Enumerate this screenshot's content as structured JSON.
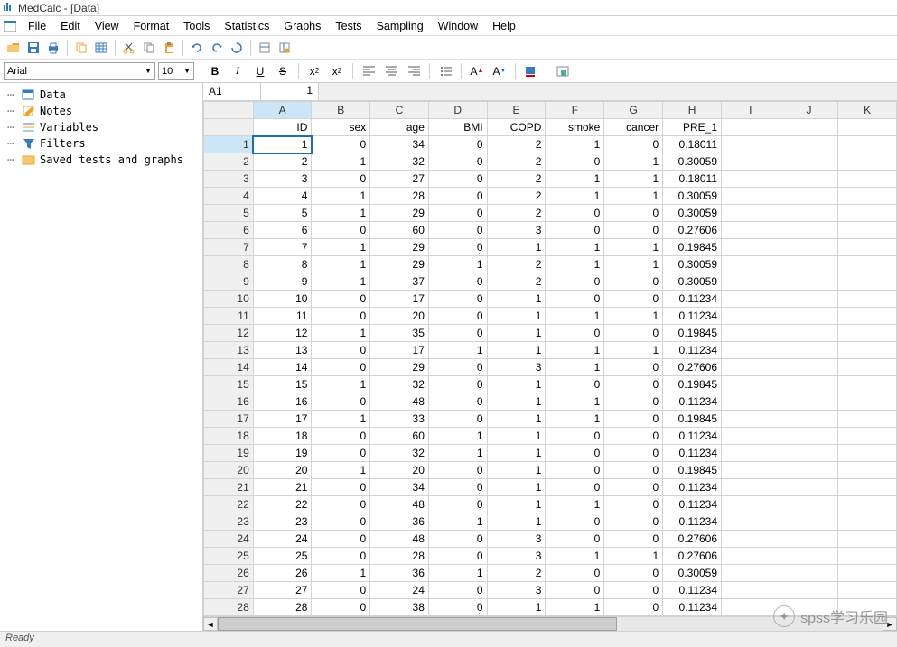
{
  "title": "MedCalc - [Data]",
  "menu": [
    "File",
    "Edit",
    "View",
    "Format",
    "Tools",
    "Statistics",
    "Graphs",
    "Tests",
    "Sampling",
    "Window",
    "Help"
  ],
  "font": {
    "name": "Arial",
    "size": "10"
  },
  "sidebar": [
    {
      "label": "Data",
      "icon": "data"
    },
    {
      "label": "Notes",
      "icon": "notes"
    },
    {
      "label": "Variables",
      "icon": "vars"
    },
    {
      "label": "Filters",
      "icon": "filter"
    },
    {
      "label": "Saved tests and graphs",
      "icon": "saved"
    }
  ],
  "cellref": "A1",
  "cellval": "1",
  "columns": [
    "A",
    "B",
    "C",
    "D",
    "E",
    "F",
    "G",
    "H",
    "I",
    "J",
    "K"
  ],
  "headers": [
    "ID",
    "sex",
    "age",
    "BMI",
    "COPD",
    "smoke",
    "cancer",
    "PRE_1",
    "",
    "",
    ""
  ],
  "rows": [
    [
      1,
      0,
      34,
      0,
      2,
      1,
      0,
      "0.18011"
    ],
    [
      2,
      1,
      32,
      0,
      2,
      0,
      1,
      "0.30059"
    ],
    [
      3,
      0,
      27,
      0,
      2,
      1,
      1,
      "0.18011"
    ],
    [
      4,
      1,
      28,
      0,
      2,
      1,
      1,
      "0.30059"
    ],
    [
      5,
      1,
      29,
      0,
      2,
      0,
      0,
      "0.30059"
    ],
    [
      6,
      0,
      60,
      0,
      3,
      0,
      0,
      "0.27606"
    ],
    [
      7,
      1,
      29,
      0,
      1,
      1,
      1,
      "0.19845"
    ],
    [
      8,
      1,
      29,
      1,
      2,
      1,
      1,
      "0.30059"
    ],
    [
      9,
      1,
      37,
      0,
      2,
      0,
      0,
      "0.30059"
    ],
    [
      10,
      0,
      17,
      0,
      1,
      0,
      0,
      "0.11234"
    ],
    [
      11,
      0,
      20,
      0,
      1,
      1,
      1,
      "0.11234"
    ],
    [
      12,
      1,
      35,
      0,
      1,
      0,
      0,
      "0.19845"
    ],
    [
      13,
      0,
      17,
      1,
      1,
      1,
      1,
      "0.11234"
    ],
    [
      14,
      0,
      29,
      0,
      3,
      1,
      0,
      "0.27606"
    ],
    [
      15,
      1,
      32,
      0,
      1,
      0,
      0,
      "0.19845"
    ],
    [
      16,
      0,
      48,
      0,
      1,
      1,
      0,
      "0.11234"
    ],
    [
      17,
      1,
      33,
      0,
      1,
      1,
      0,
      "0.19845"
    ],
    [
      18,
      0,
      60,
      1,
      1,
      0,
      0,
      "0.11234"
    ],
    [
      19,
      0,
      32,
      1,
      1,
      0,
      0,
      "0.11234"
    ],
    [
      20,
      1,
      20,
      0,
      1,
      0,
      0,
      "0.19845"
    ],
    [
      21,
      0,
      34,
      0,
      1,
      0,
      0,
      "0.11234"
    ],
    [
      22,
      0,
      48,
      0,
      1,
      1,
      0,
      "0.11234"
    ],
    [
      23,
      0,
      36,
      1,
      1,
      0,
      0,
      "0.11234"
    ],
    [
      24,
      0,
      48,
      0,
      3,
      0,
      0,
      "0.27606"
    ],
    [
      25,
      0,
      28,
      0,
      3,
      1,
      1,
      "0.27606"
    ],
    [
      26,
      1,
      36,
      1,
      2,
      0,
      0,
      "0.30059"
    ],
    [
      27,
      0,
      24,
      0,
      3,
      0,
      0,
      "0.11234"
    ],
    [
      28,
      0,
      38,
      0,
      1,
      1,
      0,
      "0.11234"
    ]
  ],
  "status": "Ready",
  "watermark": "spss学习乐园"
}
